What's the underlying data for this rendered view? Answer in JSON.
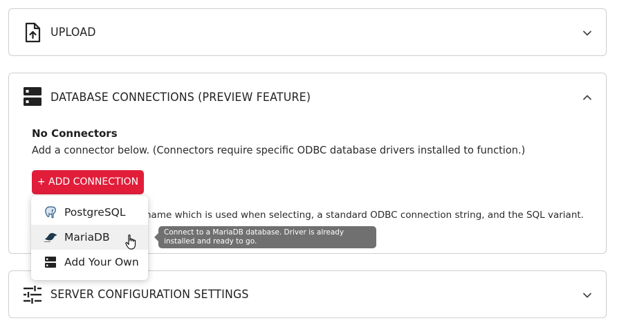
{
  "upload": {
    "title": "UPLOAD",
    "icon": "file-upload-icon"
  },
  "db": {
    "title": "DATABASE CONNECTIONS (PREVIEW FEATURE)",
    "icon": "database-server-icon",
    "no_connectors": "No Connectors",
    "description": "Add a connector below. (Connectors require specific ODBC database drivers installed to function.)",
    "add_button": "+ ADD CONNECTION",
    "hint_partial": "name which is used when selecting, a standard ODBC connection string, and the SQL variant."
  },
  "menu": {
    "items": [
      {
        "label": "PostgreSQL",
        "icon": "postgresql-icon"
      },
      {
        "label": "MariaDB",
        "icon": "mariadb-icon"
      },
      {
        "label": "Add Your Own",
        "icon": "database-server-icon"
      }
    ],
    "hovered_index": 1
  },
  "tooltip": {
    "text": "Connect to a MariaDB database. Driver is already installed and ready to go."
  },
  "server": {
    "title": "SERVER CONFIGURATION SETTINGS",
    "icon": "tune-sliders-icon"
  },
  "colors": {
    "accent": "#e11d3a",
    "tooltip_bg": "#707070",
    "border": "#cfcfcf"
  }
}
